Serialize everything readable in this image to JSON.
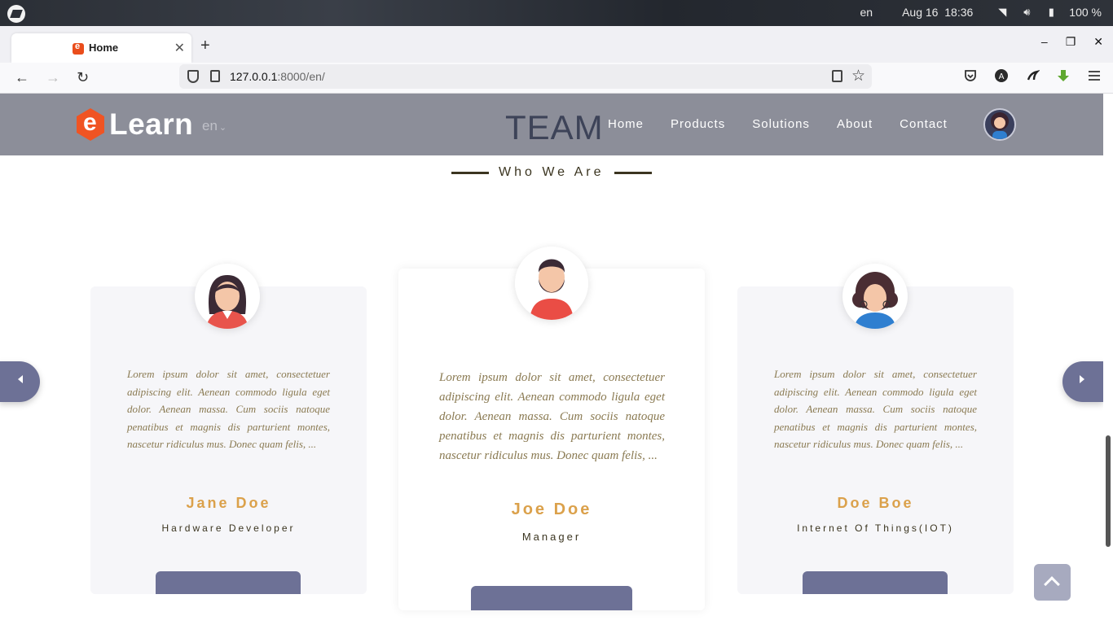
{
  "os": {
    "lang": "en",
    "date": "Aug 16",
    "time": "18:36",
    "battery": "100 %"
  },
  "browser": {
    "tab_title": "Home",
    "url_host": "127.0.0.1",
    "url_rest": ":8000/en/"
  },
  "site": {
    "brand": "Learn",
    "lang": "en",
    "section_title": "TEAM",
    "nav": [
      "Home",
      "Products",
      "Solutions",
      "About",
      "Contact"
    ],
    "subheading": "Who We Are"
  },
  "team": [
    {
      "name": "Jane Doe",
      "role": "Hardware Developer",
      "text": "Lorem ipsum dolor sit amet, consectetuer adipiscing elit. Aenean commodo ligula eget dolor. Aenean massa. Cum sociis natoque penatibus et magnis dis parturient montes, nascetur ridiculus mus. Donec quam felis, ..."
    },
    {
      "name": "Joe Doe",
      "role": "Manager",
      "text": "Lorem ipsum dolor sit amet, consectetuer adipiscing elit. Aenean commodo ligula eget dolor. Aenean massa. Cum sociis natoque penatibus et magnis dis parturient montes, nascetur ridiculus mus. Donec quam felis, ..."
    },
    {
      "name": "Doe Boe",
      "role": "Internet Of Things(IOT)",
      "text": "Lorem ipsum dolor sit amet, consectetuer adipiscing elit. Aenean commodo ligula eget dolor. Aenean massa. Cum sociis natoque penatibus et magnis dis parturient montes, nascetur ridiculus mus. Donec quam felis, ..."
    }
  ],
  "colors": {
    "header_bg": "#8c8e99",
    "accent_orange": "#f05423",
    "name_gold": "#dba14b",
    "button_slate": "#6d7196"
  }
}
